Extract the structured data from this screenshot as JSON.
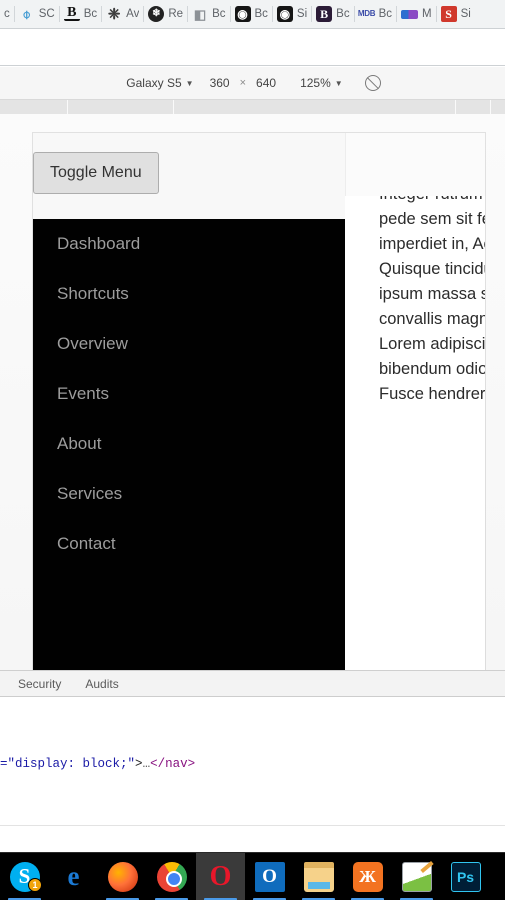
{
  "browser": {
    "bookmarks": [
      {
        "label": "c",
        "icon": "partial-bookmark-icon",
        "glyph": "",
        "cls": "bm-partial"
      },
      {
        "label": "SC",
        "icon": "cloud-icon",
        "glyph": "⌽",
        "cls": "ico-cloud"
      },
      {
        "label": "Bc",
        "icon": "bold-b-icon",
        "glyph": "B",
        "cls": "ico-b-black"
      },
      {
        "label": "Av",
        "icon": "diamond-icon",
        "glyph": "❈",
        "cls": "ico-diamond"
      },
      {
        "label": "Re",
        "icon": "snowflake-dark-icon",
        "glyph": "❄",
        "cls": "ico-snow"
      },
      {
        "label": "Bc",
        "icon": "page-document-icon",
        "glyph": "◧",
        "cls": "ico-page"
      },
      {
        "label": "Bc",
        "icon": "eye-dark-icon",
        "glyph": "◉",
        "cls": "ico-eye"
      },
      {
        "label": "Si",
        "icon": "eye-dark-icon",
        "glyph": "◉",
        "cls": "ico-eye"
      },
      {
        "label": "Bc",
        "icon": "bootstrap-icon",
        "glyph": "B",
        "cls": "ico-bootstrap"
      },
      {
        "label": "Bc",
        "icon": "mdb-icon",
        "glyph": "MDB",
        "cls": "ico-mdb"
      },
      {
        "label": "M",
        "icon": "color-strip-icon",
        "glyph": "",
        "cls": "ico-strip"
      },
      {
        "label": "Si",
        "icon": "s-red-icon",
        "glyph": "S",
        "cls": "ico-s-red"
      }
    ]
  },
  "device_toolbar": {
    "device_name": "Galaxy S5",
    "device_caret": "▼",
    "width": "360",
    "times": "×",
    "height": "640",
    "zoom": "125%",
    "zoom_caret": "▼",
    "throttle_icon": "no-throttling-icon"
  },
  "page": {
    "toggle_button": "Toggle Menu",
    "nav_items": [
      {
        "label": "Dashboard"
      },
      {
        "label": "Shortcuts"
      },
      {
        "label": "Overview"
      },
      {
        "label": "Events"
      },
      {
        "label": "About"
      },
      {
        "label": "Services"
      },
      {
        "label": "Contact"
      }
    ],
    "body_text": "Integer rutrum ante ultricies, lacus pede sem sit felis nonummy imperdiet in, Aenean vel nisl Quisque tincidunt libero. Etiam ipsum massa scelerisque sem convallis magna dapibus nec, urna. Lorem adipiscing elit vulputate, erat bibendum odio volutpat. Nunc urna. Fusce hendrerit ante"
  },
  "devtools": {
    "tabs": [
      {
        "label": "Security"
      },
      {
        "label": "Audits"
      }
    ],
    "code": {
      "attr_open": "=",
      "string": "\"display: block;\"",
      "gt": ">",
      "ellipsis": "…",
      "close_tag": "</nav>"
    }
  },
  "taskbar": {
    "items": [
      {
        "name": "skype",
        "icon": "skype-icon",
        "glyph": "S",
        "cls": "g-skype",
        "active": false,
        "badge": "1",
        "running": true
      },
      {
        "name": "edge",
        "icon": "edge-icon",
        "glyph": "e",
        "cls": "g-edge",
        "active": false,
        "badge": "",
        "running": false
      },
      {
        "name": "firefox",
        "icon": "firefox-icon",
        "glyph": "",
        "cls": "g-firefox",
        "active": false,
        "badge": "",
        "running": true
      },
      {
        "name": "chrome",
        "icon": "chrome-icon",
        "glyph": "",
        "cls": "g-chrome",
        "active": false,
        "badge": "",
        "running": true
      },
      {
        "name": "opera",
        "icon": "opera-icon",
        "glyph": "O",
        "cls": "g-opera",
        "active": true,
        "badge": "",
        "running": true
      },
      {
        "name": "outlook",
        "icon": "outlook-icon",
        "glyph": "O",
        "cls": "g-outlook",
        "active": false,
        "badge": "",
        "running": true
      },
      {
        "name": "explorer",
        "icon": "folder-icon",
        "glyph": "",
        "cls": "g-folder",
        "active": false,
        "badge": "",
        "running": true
      },
      {
        "name": "xampp",
        "icon": "xampp-icon",
        "glyph": "Ж",
        "cls": "g-xampp",
        "active": false,
        "badge": "",
        "running": true
      },
      {
        "name": "editor",
        "icon": "editor-icon",
        "glyph": "",
        "cls": "g-editor",
        "active": false,
        "badge": "",
        "running": true
      },
      {
        "name": "photoshop",
        "icon": "photoshop-icon",
        "glyph": "Ps",
        "cls": "g-ps",
        "active": false,
        "badge": "",
        "running": false
      }
    ]
  }
}
